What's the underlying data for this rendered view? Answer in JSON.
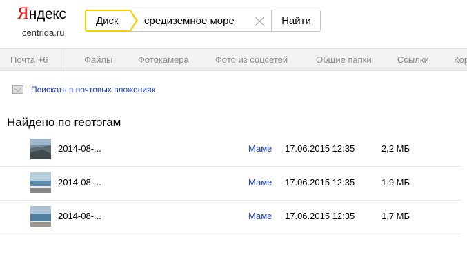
{
  "header": {
    "logo_first": "Я",
    "logo_rest": "ндекс",
    "domain": "centrida.ru",
    "service_tab": "Диск",
    "search_value": "средиземное море",
    "search_button": "Найти"
  },
  "nav": {
    "items": [
      "Почта +6",
      "Файлы",
      "Фотокамера",
      "Фото из соцсетей",
      "Общие папки",
      "Ссылки",
      "Кор"
    ]
  },
  "mail_search": "Поискать в почтовых вложениях",
  "section_title": "Найдено по геотэгам",
  "results": [
    {
      "name": "2014-08-...",
      "folder": "Маме",
      "date": "17.06.2015 12:35",
      "size": "2,2 МБ"
    },
    {
      "name": "2014-08-...",
      "folder": "Маме",
      "date": "17.06.2015 12:35",
      "size": "1,9 МБ"
    },
    {
      "name": "2014-08-...",
      "folder": "Маме",
      "date": "17.06.2015 12:35",
      "size": "1,7 МБ"
    }
  ],
  "colors": {
    "logo_red": "#ff0000",
    "accent_yellow": "#ffcc00",
    "link_blue": "#1a3dc1"
  }
}
